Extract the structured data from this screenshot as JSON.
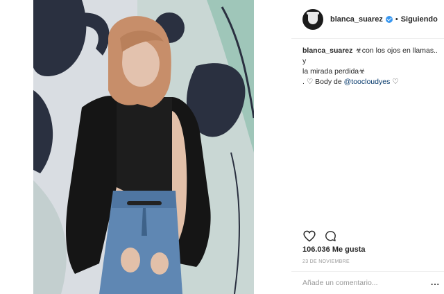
{
  "post": {
    "username": "blanca_suarez",
    "follow_status": "Siguiendo",
    "separator": "•",
    "caption_user": "blanca_suarez",
    "caption_line1": "☣con los ojos en llamas.. y",
    "caption_line2": "la mirada perdida☣",
    "caption_line3_prefix": ". ♡ Body de ",
    "caption_mention": "@toocloudyes",
    "caption_line3_suffix": " ♡",
    "likes": "106.036 Me gusta",
    "date": "23 DE NOVIEMBRE"
  },
  "comment": {
    "placeholder": "Añade un comentario...",
    "more": "..."
  },
  "icons": {
    "like": "heart-icon",
    "comment": "comment-bubble-icon",
    "verified": "verified-badge-icon",
    "more": "more-options-icon"
  },
  "colors": {
    "verified": "#3897f0",
    "mention": "#003569",
    "muted_text": "#999999",
    "text": "#262626"
  }
}
